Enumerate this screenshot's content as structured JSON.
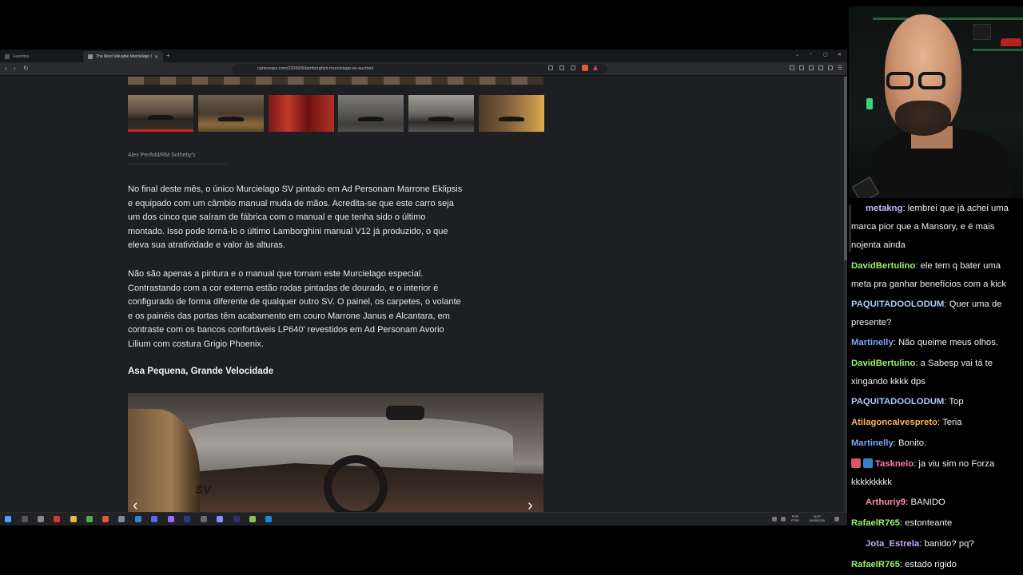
{
  "browser": {
    "tabs": [
      {
        "label": "Favoritos"
      },
      {
        "label": "The Most Valuable Murcielago I"
      }
    ],
    "url": "carscoops.com/2026/05/lamborghini-murcielago-sv-auction/"
  },
  "article": {
    "photo_credit": "Alex Penfold/RM Sotheby's",
    "paragraphs": [
      "No final deste mês, o único Murcielago SV pintado em Ad Personam Marrone Eklipsis e equipado com um câmbio manual muda de mãos. Acredita-se que este carro seja um dos cinco que saíram de fábrica com o manual e que tenha sido o último montado. Isso pode torná-lo o último Lamborghini manual V12 já produzido, o que eleva sua atratividade e valor às alturas.",
      "Não são apenas a pintura e o manual que tornam este Murcielago especial. Contrastando com a cor externa estão rodas pintadas de dourado, e o interior é configurado de forma diferente de qualquer outro SV. O painel, os carpetes, o volante e os painéis das portas têm acabamento em couro Marrone Janus e Alcantara, em contraste com os bancos confortáveis LP640' revestidos em Ad Personam Avorio Lilium com costura Grigio Phoenix."
    ],
    "section_heading": "Asa Pequena, Grande Velocidade",
    "photo_mark": "SV"
  },
  "taskbar": {
    "lang": "POR\nPTB2",
    "time": "15:57",
    "date": "16/05/2026"
  },
  "chat": {
    "messages": [
      {
        "user": "metakng",
        "color": "#c9b8ff",
        "text": "lembrei que já achei uma marca pior que a Mansory, e é mais nojenta ainda",
        "indent": true
      },
      {
        "user": "DavidBertulino",
        "color": "#9cf26b",
        "text": "ele tem q bater uma meta pra ganhar benefícios com a kick",
        "indent": false
      },
      {
        "user": "PAQUITADOOLODUM",
        "color": "#b0c8ff",
        "text": "Quer uma de presente?",
        "indent": false
      },
      {
        "user": "Martinelly",
        "color": "#7ea6ff",
        "text": "Não queime meus olhos.",
        "indent": false
      },
      {
        "user": "DavidBertulino",
        "color": "#9cf26b",
        "text": "a Sabesp vai tá te xingando kkkk dps",
        "indent": false
      },
      {
        "user": "PAQUITADOOLODUM",
        "color": "#b0c8ff",
        "text": "Top",
        "indent": false
      },
      {
        "user": "Atilagoncalvespreto",
        "color": "#ffb45a",
        "text": "Teria",
        "indent": false
      },
      {
        "user": "Martinelly",
        "color": "#7ea6ff",
        "text": "Bonito.",
        "indent": false
      },
      {
        "user": "Tasknelo",
        "color": "#ff7ab8",
        "text": "ja viu sim no Forza kkkkkkkkk",
        "indent": false,
        "badges": true
      },
      {
        "user": "Arthuriy9",
        "color": "#ff8fa8",
        "text": "BANIDO",
        "indent": true
      },
      {
        "user": "RafaelR765",
        "color": "#9cf26b",
        "text": "estonteante",
        "indent": false
      },
      {
        "user": "Jota_Estrela",
        "color": "#c9a6ff",
        "text": "banido? pq?",
        "indent": true
      },
      {
        "user": "RafaelR765",
        "color": "#9cf26b",
        "text": "estado rigido",
        "indent": false
      }
    ]
  }
}
